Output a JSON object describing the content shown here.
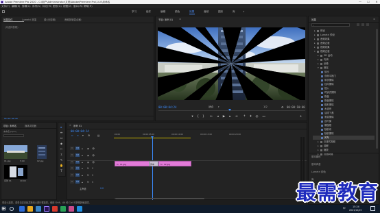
{
  "title_bar": {
    "title": "Adobe Premiere Pro 2020 - C:\\用户\\Administrator\\文档\\Adobe\\Premiere Pro\\14.0\\未命名",
    "minimize": "—",
    "maximize": "☐",
    "close": "✕"
  },
  "menu": [
    "文件(F)",
    "编辑(E)",
    "剪辑(C)",
    "序列(S)",
    "标记(M)",
    "图形(G)",
    "视图(V)",
    "窗口(W)",
    "帮助(H)"
  ],
  "workspaces": [
    "学习",
    "组件",
    "编辑",
    "颜色",
    "效果",
    "音频",
    "图形",
    "库"
  ],
  "active_workspace": "效果",
  "source_panel": {
    "tabs": [
      "效果控件",
      "Lumetri 范围",
      "源:(无剪辑)",
      "音频剪辑混合器:"
    ],
    "message": "(未选择剪辑)"
  },
  "program_monitor": {
    "tab": "节目: 序列 01",
    "timecode_current": "00:00:04:24",
    "fit": "适合",
    "quality": "1/2",
    "timecode_total": "00:00:10:00"
  },
  "effects_panel": {
    "title": "效果",
    "search_placeholder": "",
    "items": [
      {
        "label": "预设",
        "level": 0,
        "type": "folder",
        "expanded": false
      },
      {
        "label": "Lumetri 预设",
        "level": 0,
        "type": "folder",
        "expanded": false
      },
      {
        "label": "音频效果",
        "level": 0,
        "type": "folder",
        "expanded": false
      },
      {
        "label": "音频过渡",
        "level": 0,
        "type": "folder",
        "expanded": false
      },
      {
        "label": "视频效果",
        "level": 0,
        "type": "folder",
        "expanded": false
      },
      {
        "label": "视频过渡",
        "level": 0,
        "type": "folder",
        "expanded": true
      },
      {
        "label": "3D 运动",
        "level": 1,
        "type": "folder",
        "expanded": false
      },
      {
        "label": "内滑",
        "level": 1,
        "type": "folder",
        "expanded": false
      },
      {
        "label": "划像",
        "level": 1,
        "type": "folder",
        "expanded": false
      },
      {
        "label": "擦除",
        "level": 1,
        "type": "folder",
        "expanded": true
      },
      {
        "label": "划出",
        "level": 2,
        "type": "effect"
      },
      {
        "label": "双侧平推门",
        "level": 2,
        "type": "effect"
      },
      {
        "label": "带状擦除",
        "level": 2,
        "type": "effect"
      },
      {
        "label": "径向擦除",
        "level": 2,
        "type": "effect"
      },
      {
        "label": "插入",
        "level": 2,
        "type": "effect"
      },
      {
        "label": "时钟式擦除",
        "level": 2,
        "type": "effect"
      },
      {
        "label": "棋盘",
        "level": 2,
        "type": "effect"
      },
      {
        "label": "棋盘擦除",
        "level": 2,
        "type": "effect"
      },
      {
        "label": "楔形擦除",
        "level": 2,
        "type": "effect"
      },
      {
        "label": "水波块",
        "level": 2,
        "type": "effect"
      },
      {
        "label": "油漆飞溅",
        "level": 2,
        "type": "effect"
      },
      {
        "label": "渐变擦除",
        "level": 2,
        "type": "effect"
      },
      {
        "label": "百叶窗",
        "level": 2,
        "type": "effect"
      },
      {
        "label": "螺旋框",
        "level": 2,
        "type": "effect"
      },
      {
        "label": "随机块",
        "level": 2,
        "type": "effect"
      },
      {
        "label": "随机擦除",
        "level": 2,
        "type": "effect"
      },
      {
        "label": "风车",
        "level": 2,
        "type": "effect",
        "selected": true
      },
      {
        "label": "沉浸式视频",
        "level": 1,
        "type": "folder",
        "expanded": false
      },
      {
        "label": "溶解",
        "level": 1,
        "type": "folder",
        "expanded": false
      },
      {
        "label": "缩放",
        "level": 1,
        "type": "folder",
        "expanded": false
      },
      {
        "label": "页面剥落",
        "level": 1,
        "type": "folder",
        "expanded": false
      }
    ],
    "bottom_panels": [
      "基本图形",
      "基本声音",
      "Lumetri 颜色",
      "库",
      "标记"
    ]
  },
  "project_panel": {
    "tabs": [
      "项目: 未命名",
      "媒体浏览器"
    ],
    "project_file": "未命名.prproj",
    "items": [
      {
        "name": "01.jpg",
        "duration": "5:00"
      },
      {
        "name": "02.jpg",
        "duration": "5:00"
      },
      {
        "name": "序列 01",
        "duration": "10:00"
      }
    ]
  },
  "tools": [
    "▸",
    "⇹",
    "⇔",
    "◆",
    "✂",
    "⇳",
    "✎",
    "✋",
    "T"
  ],
  "timeline": {
    "tab": "序列 01",
    "timecode": "00:00:04:24",
    "ruler": [
      ":00:00",
      "00:00:05:00",
      "00:00:10:00",
      "00:00:15:00",
      "00:00:20:00"
    ],
    "video_tracks": [
      "V3",
      "V2",
      "V1"
    ],
    "audio_tracks": [
      "A1",
      "A2",
      "A3"
    ],
    "master": "主声道",
    "master_value": "0.0",
    "clips": [
      {
        "name": "01.jpg",
        "track": "V1"
      },
      {
        "name": "风车",
        "track": "V1"
      },
      {
        "name": "02.jpg",
        "track": "V1"
      }
    ]
  },
  "status_bar": {
    "text": "单击以选择，或单击空白处并拖动以进行框选择。使用 Shift、Alt 和 Ctrl 可获得其他选项。"
  },
  "taskbar": {
    "clock": "15:24",
    "date": "2021/10/15",
    "lang": "中"
  },
  "watermark": "最需教育"
}
